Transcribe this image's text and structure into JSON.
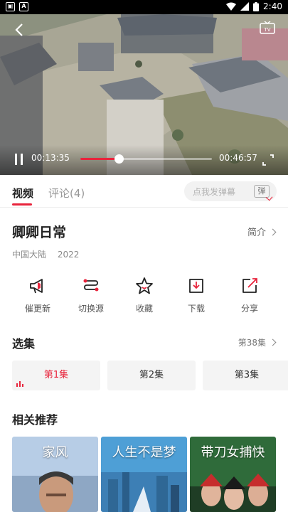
{
  "status_bar": {
    "time": "2:40"
  },
  "player": {
    "current_time": "00:13:35",
    "total_time": "46:57",
    "total_time_display": "00:46:57",
    "progress_fraction": 0.29
  },
  "tabs": [
    {
      "label": "视频",
      "active": true
    },
    {
      "label": "评论(4)",
      "active": false
    }
  ],
  "danmu": {
    "placeholder": "点我发弹幕",
    "button": "弹"
  },
  "show": {
    "title": "卿卿日常",
    "intro_link": "简介",
    "region": "中国大陆",
    "year": "2022"
  },
  "actions": [
    {
      "label": "催更新",
      "icon": "megaphone-icon"
    },
    {
      "label": "切换源",
      "icon": "switch-source-icon"
    },
    {
      "label": "收藏",
      "icon": "star-icon"
    },
    {
      "label": "下载",
      "icon": "download-icon"
    },
    {
      "label": "分享",
      "icon": "share-icon"
    }
  ],
  "episodes": {
    "heading": "选集",
    "more": "第38集",
    "items": [
      {
        "label": "第1集",
        "active": true
      },
      {
        "label": "第2集",
        "active": false
      },
      {
        "label": "第3集",
        "active": false
      }
    ]
  },
  "related": {
    "heading": "相关推荐",
    "items": [
      {
        "poster_title": "家风"
      },
      {
        "poster_title": "人生不是梦"
      },
      {
        "poster_title": "带刀女捕快"
      }
    ]
  },
  "colors": {
    "accent": "#e8243c",
    "muted": "#999999",
    "chip_bg": "#f4f4f4"
  }
}
